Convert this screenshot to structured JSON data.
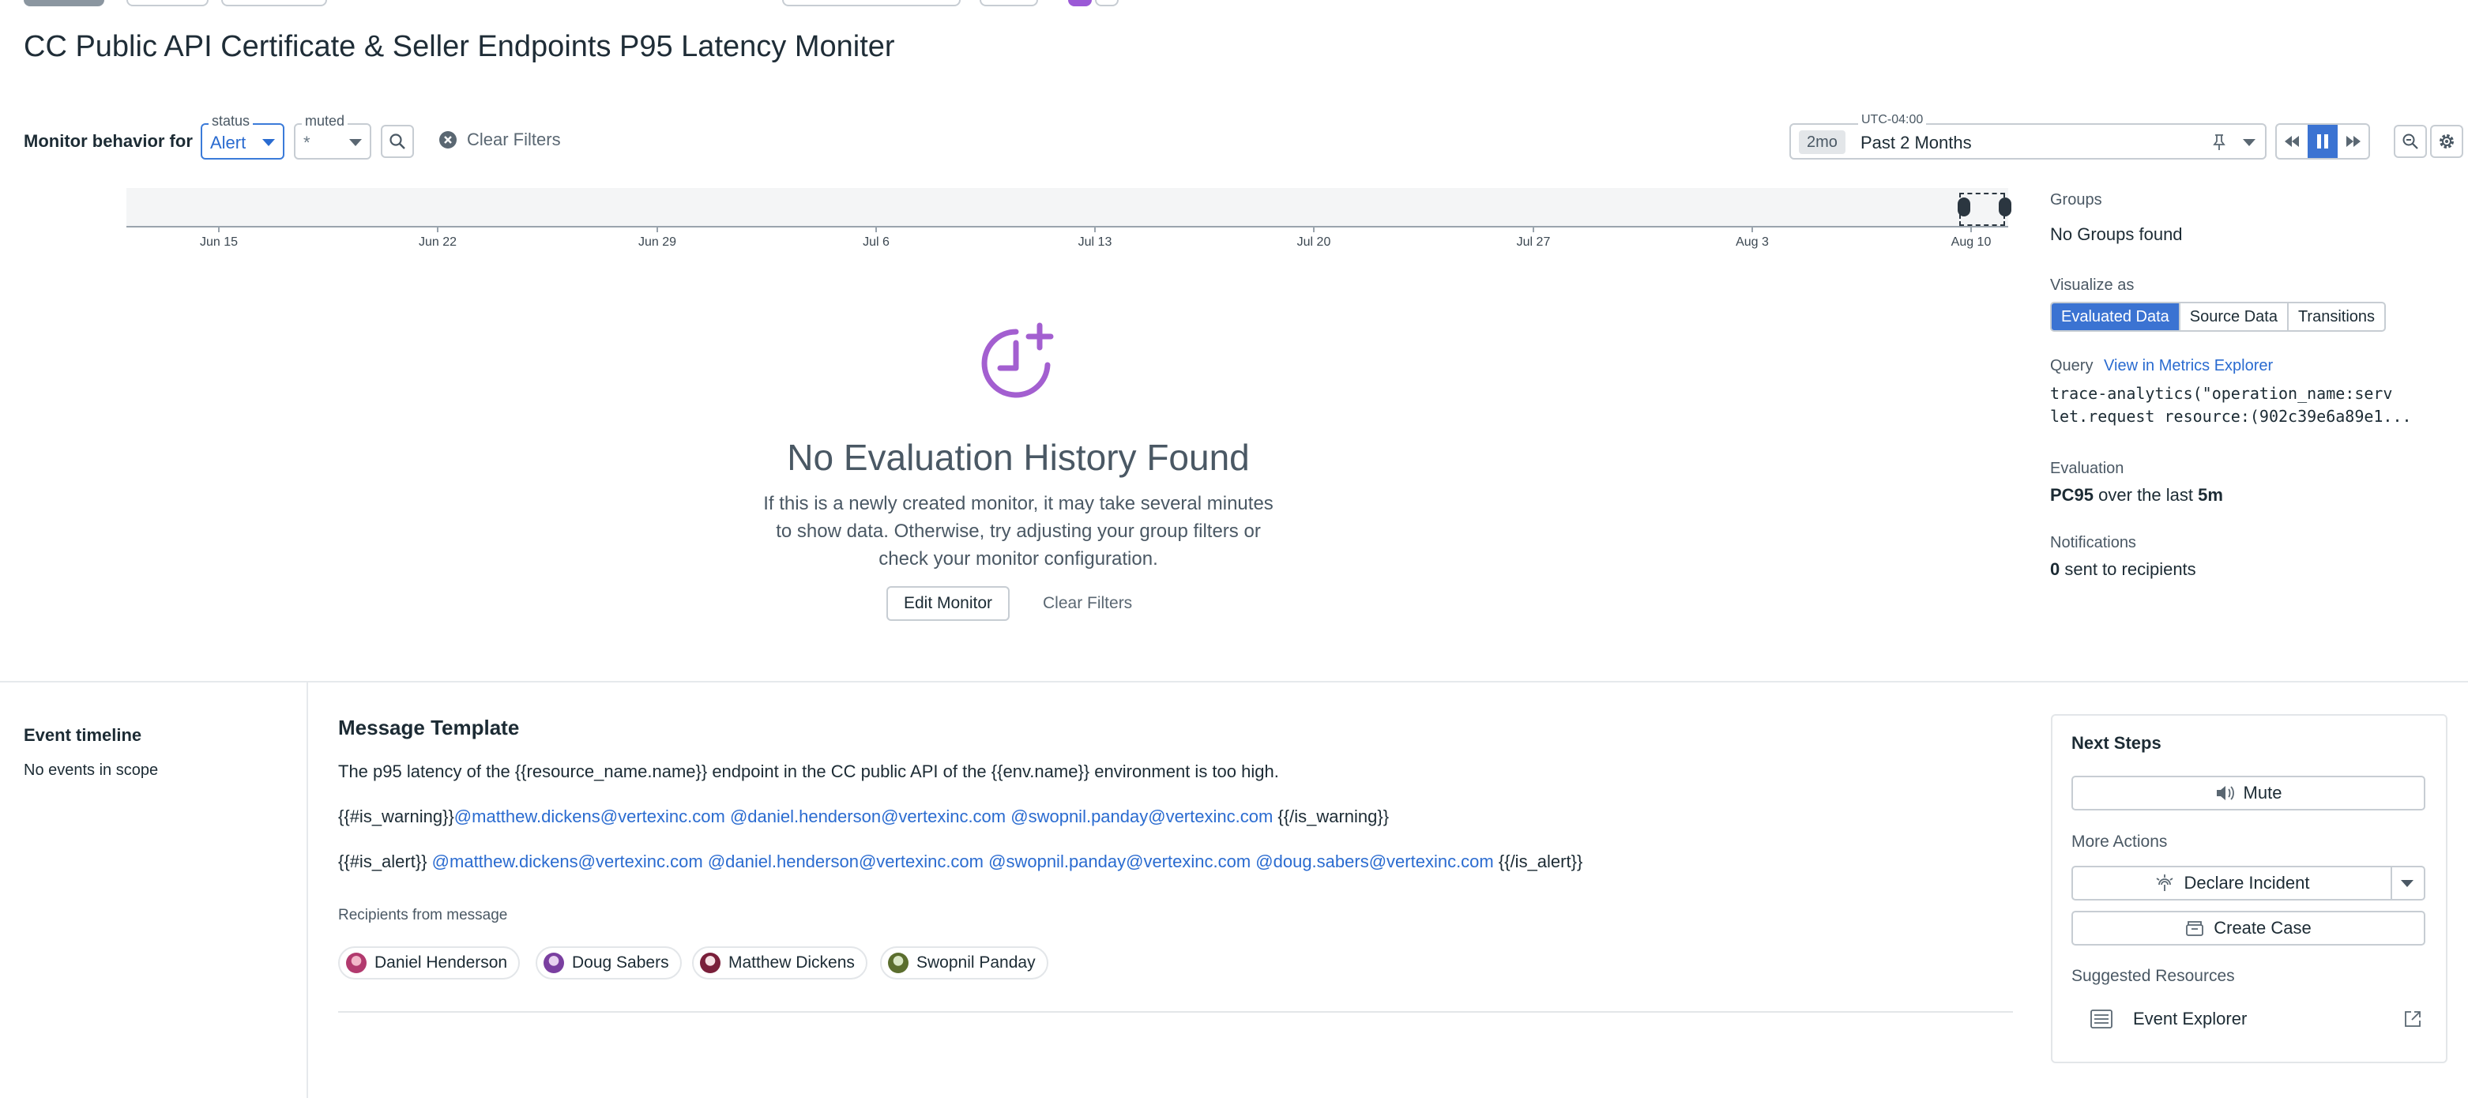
{
  "page_title": "CC Public API Certificate & Seller Endpoints P95 Latency Moniter",
  "filters": {
    "label": "Monitor behavior for",
    "status_legend": "status",
    "status_value": "Alert",
    "muted_legend": "muted",
    "muted_value": "*",
    "clear_filters": "Clear Filters"
  },
  "time": {
    "timezone": "UTC-04:00",
    "badge": "2mo",
    "range": "Past 2 Months"
  },
  "timeline": {
    "ticks": [
      "Jun 15",
      "Jun 22",
      "Jun 29",
      "Jul 6",
      "Jul 13",
      "Jul 20",
      "Jul 27",
      "Aug 3",
      "Aug 10"
    ]
  },
  "empty_state": {
    "title": "No Evaluation History Found",
    "description": "If this is a newly created monitor, it may take several minutes to show data. Otherwise, try adjusting your group filters or check your monitor configuration.",
    "edit_button": "Edit Monitor",
    "clear_button": "Clear Filters"
  },
  "right_panel": {
    "groups_label": "Groups",
    "groups_value": "No Groups found",
    "visualize_label": "Visualize as",
    "visualize_options": [
      "Evaluated Data",
      "Source Data",
      "Transitions"
    ],
    "query_label": "Query",
    "query_link": "View in Metrics Explorer",
    "query_line1": "trace-analytics(\"operation_name:serv",
    "query_line2": "let.request resource:(902c39e6a89e1...",
    "evaluation_label": "Evaluation",
    "evaluation_bold": "PC95",
    "evaluation_mid": " over the last ",
    "evaluation_window": "5m",
    "notifications_label": "Notifications",
    "notifications_count": "0",
    "notifications_text": " sent to recipients"
  },
  "event_timeline": {
    "title": "Event timeline",
    "empty": "No events in scope"
  },
  "message_template": {
    "title": "Message Template",
    "line1": "The p95 latency of the {{resource_name.name}} endpoint in the CC public API of the {{env.name}} environment is too high.",
    "warning_open": "{{#is_warning}}",
    "warning_mentions": [
      "@matthew.dickens@vertexinc.com",
      "@daniel.henderson@vertexinc.com",
      "@swopnil.panday@vertexinc.com"
    ],
    "warning_close": "{{/is_warning}}",
    "alert_open": "{{#is_alert}}",
    "alert_mentions": [
      "@matthew.dickens@vertexinc.com",
      "@daniel.henderson@vertexinc.com",
      "@swopnil.panday@vertexinc.com",
      "@doug.sabers@vertexinc.com"
    ],
    "alert_close": "{{/is_alert}}",
    "recipients_label": "Recipients from message",
    "recipients": [
      "Daniel Henderson",
      "Doug Sabers",
      "Matthew Dickens",
      "Swopnil Panday"
    ]
  },
  "next_steps": {
    "title": "Next Steps",
    "mute": "Mute",
    "more_actions": "More Actions",
    "declare_incident": "Declare Incident",
    "create_case": "Create Case",
    "suggested_resources": "Suggested Resources",
    "event_explorer": "Event Explorer"
  },
  "colors": {
    "accent": "#3b73d2",
    "link": "#2a6bd0",
    "empty_icon": "#a35fd0"
  }
}
